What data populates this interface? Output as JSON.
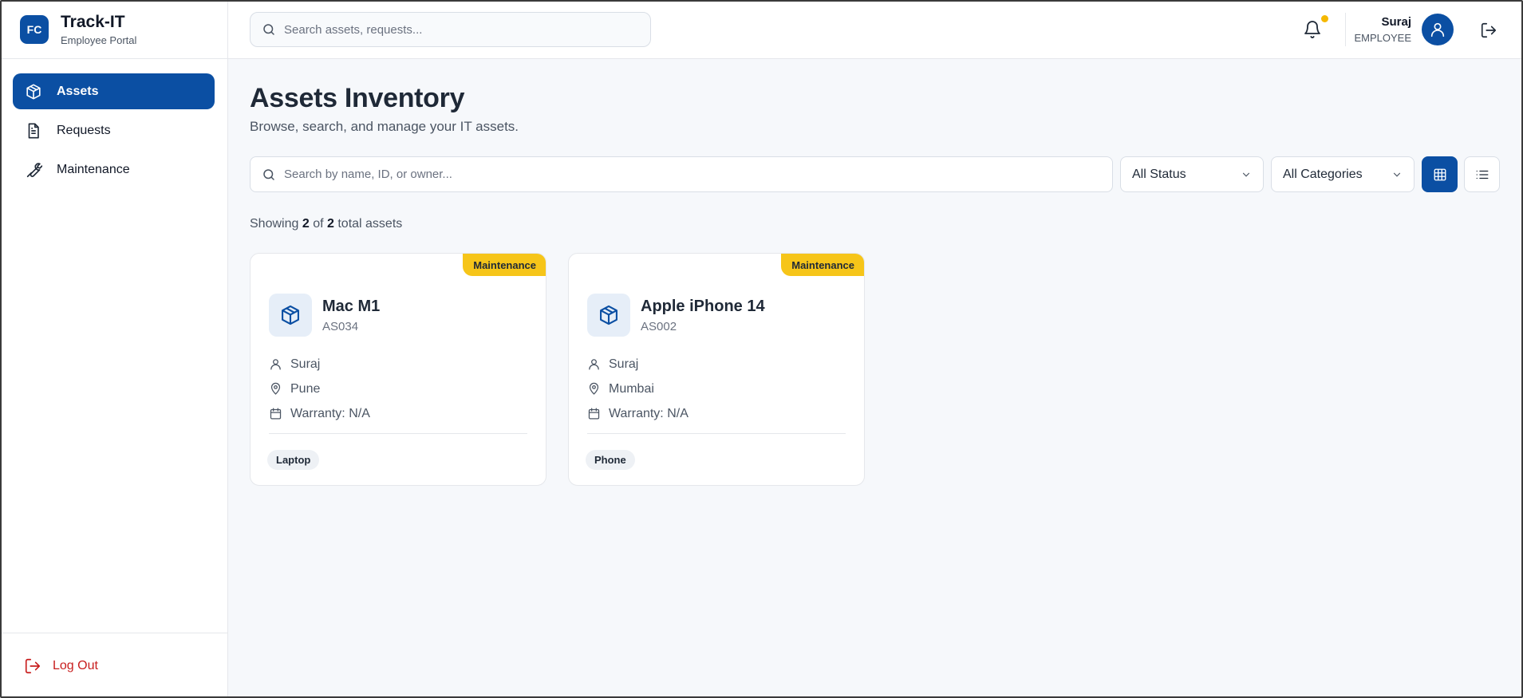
{
  "brand": {
    "initials": "FC",
    "title": "Track-IT",
    "subtitle": "Employee Portal"
  },
  "sidebar": {
    "items": [
      {
        "label": "Assets",
        "icon": "cube-icon",
        "active": true
      },
      {
        "label": "Requests",
        "icon": "document-icon",
        "active": false
      },
      {
        "label": "Maintenance",
        "icon": "wrench-icon",
        "active": false
      }
    ],
    "logout_label": "Log Out"
  },
  "header": {
    "search_placeholder": "Search assets, requests...",
    "user_name": "Suraj",
    "user_role": "EMPLOYEE"
  },
  "main": {
    "title": "Assets Inventory",
    "subtitle": "Browse, search, and manage your IT assets.",
    "filter_placeholder": "Search by name, ID, or owner...",
    "status_select": "All Status",
    "category_select": "All Categories",
    "count": {
      "prefix": "Showing",
      "shown": "2",
      "of": "of",
      "total": "2",
      "suffix": "total assets"
    }
  },
  "assets": [
    {
      "name": "Mac M1",
      "id": "AS034",
      "owner": "Suraj",
      "location": "Pune",
      "warranty": "Warranty: N/A",
      "category": "Laptop",
      "status": "Maintenance"
    },
    {
      "name": "Apple iPhone 14",
      "id": "AS002",
      "owner": "Suraj",
      "location": "Mumbai",
      "warranty": "Warranty: N/A",
      "category": "Phone",
      "status": "Maintenance"
    }
  ],
  "colors": {
    "primary": "#0b4fa3",
    "maintenance_badge": "#f6c519",
    "danger": "#c81e1e",
    "notification_dot": "#f5b800"
  }
}
